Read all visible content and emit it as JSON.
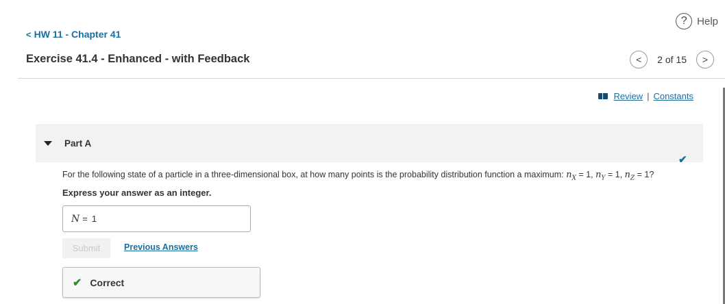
{
  "help": {
    "icon": "question-circle-icon",
    "glyph": "?",
    "label": "Help"
  },
  "nav": {
    "back_icon": "chevron-left-icon",
    "back_glyph": "<",
    "back_label": "HW 11 - Chapter 41"
  },
  "exercise": {
    "title": "Exercise 41.4 - Enhanced - with Feedback"
  },
  "pager": {
    "prev_glyph": "<",
    "position": "2 of 15",
    "next_glyph": ">"
  },
  "resources": {
    "review_label": "Review",
    "separator": "|",
    "constants_label": "Constants"
  },
  "part": {
    "label": "Part A",
    "completed_glyph": "✔"
  },
  "question": {
    "prefix": "For the following state of a particle in a three-dimensional box, at how many points is the probability distribution function a maximum: ",
    "n": "n",
    "sub_x": "X",
    "sub_y": "Y",
    "sub_z": "Z",
    "eq_x": " = 1, ",
    "eq_y": " = 1, ",
    "eq_z": " = 1?"
  },
  "instruction": "Express your answer as an integer.",
  "answer": {
    "variable": "N",
    "equals": "=",
    "value": "1"
  },
  "actions": {
    "submit_label": "Submit",
    "previous_answers_label": "Previous Answers"
  },
  "feedback": {
    "glyph": "✔",
    "label": "Correct"
  },
  "colors": {
    "link": "#1a6fa0",
    "correct": "#2e8b2e",
    "part_header_bg": "#f2f2f2"
  }
}
